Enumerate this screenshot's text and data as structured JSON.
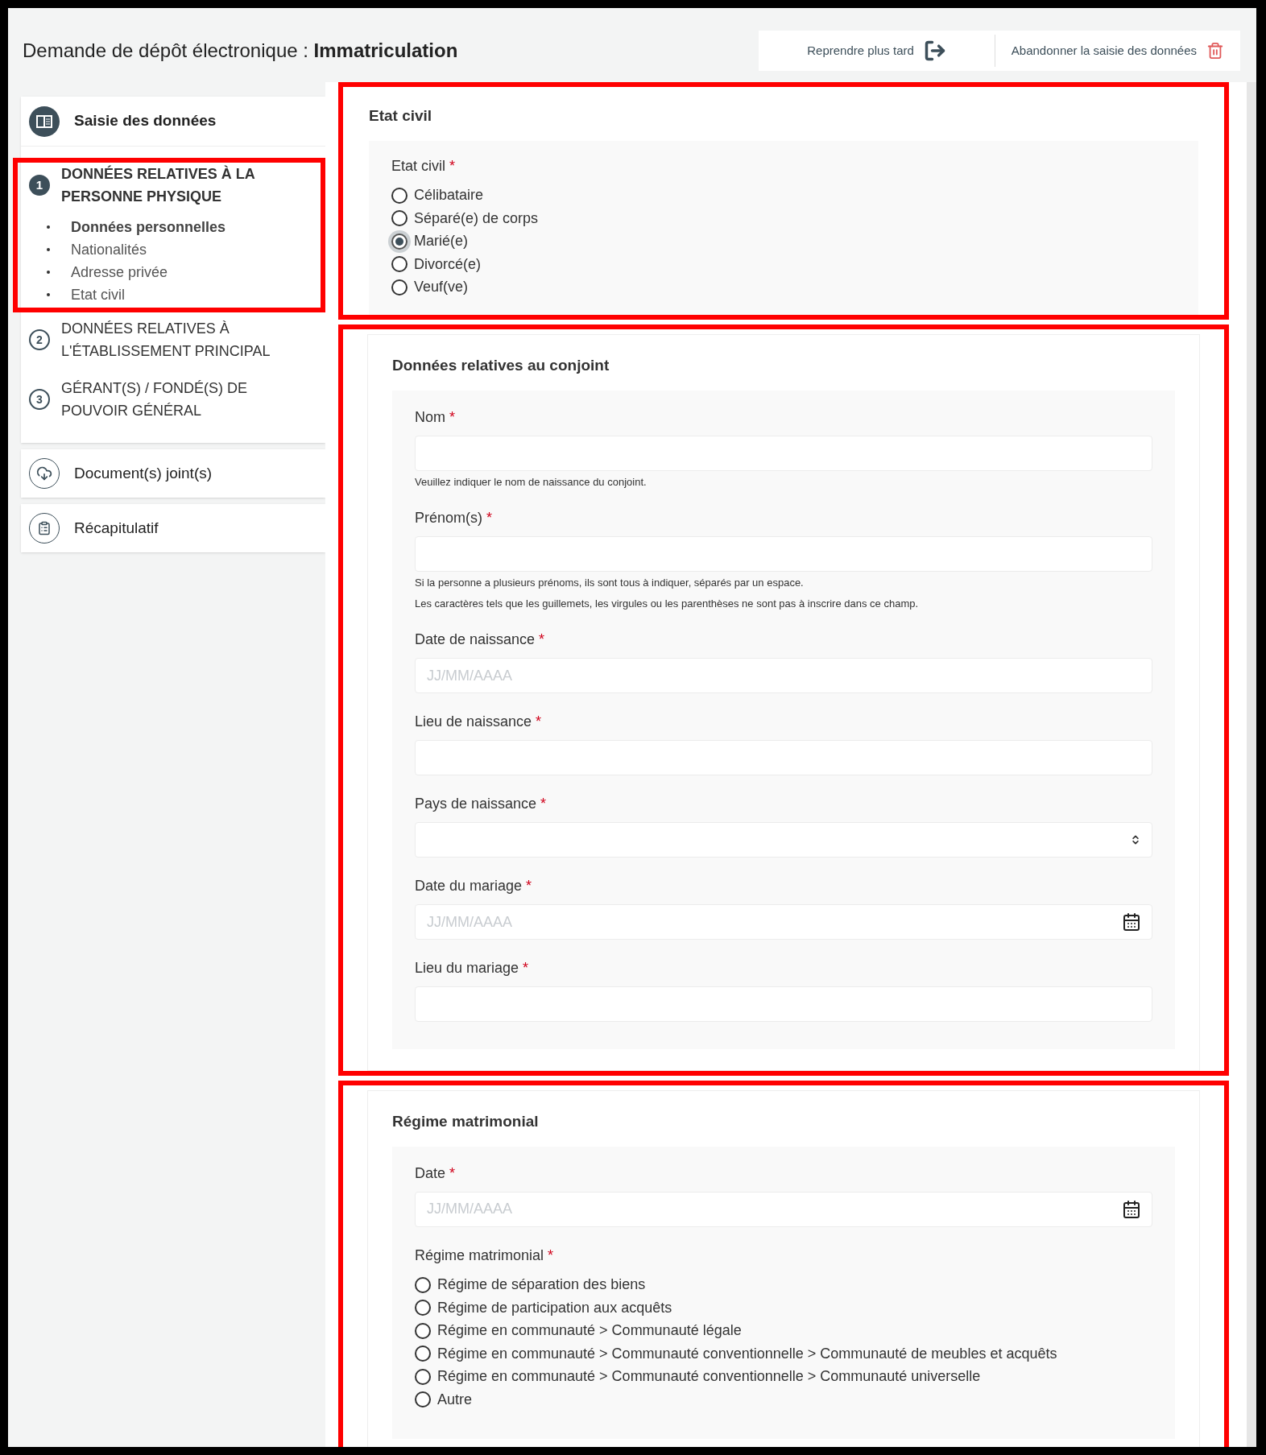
{
  "header": {
    "title_prefix": "Demande de dépôt électronique :",
    "title_bold": "Immatriculation",
    "actions": [
      {
        "kind": "resume",
        "label": "Reprendre plus tard"
      },
      {
        "kind": "abandon",
        "label": "Abandonner la saisie des données"
      }
    ]
  },
  "sidebar": {
    "title": "Saisie des données",
    "steps": [
      {
        "number": "1",
        "label_lines": [
          "DONNÉES RELATIVES À LA",
          "PERSONNE PHYSIQUE"
        ],
        "selected": true,
        "highlighted": true,
        "children": [
          {
            "label": "Données personnelles",
            "selected": true
          },
          {
            "label": "Nationalités",
            "selected": false
          },
          {
            "label": "Adresse privée",
            "selected": false
          },
          {
            "label": "Etat civil",
            "selected": false
          }
        ]
      },
      {
        "number": "2",
        "label_lines": [
          "DONNÉES RELATIVES À",
          "L'ÉTABLISSEMENT PRINCIPAL"
        ],
        "selected": false,
        "highlighted": false
      },
      {
        "number": "3",
        "label_lines": [
          "GÉRANT(S) / FONDÉ(S) DE",
          "POUVOIR GÉNÉRAL"
        ],
        "selected": false,
        "highlighted": false
      }
    ],
    "extra_items": [
      {
        "kind": "upload",
        "label": "Document(s) joint(s)"
      },
      {
        "kind": "summary",
        "label": "Récapitulatif"
      }
    ]
  },
  "sections": [
    {
      "title": "Etat civil",
      "highlighted": true,
      "fields": [
        {
          "kind": "radio",
          "label": "Etat civil",
          "required_mark": "*",
          "options": [
            {
              "label": "Célibataire",
              "selected": false
            },
            {
              "label": "Séparé(e) de corps",
              "selected": false
            },
            {
              "label": "Marié(e)",
              "selected": true
            },
            {
              "label": "Divorcé(e)",
              "selected": false
            },
            {
              "label": "Veuf(ve)",
              "selected": false
            }
          ]
        }
      ]
    },
    {
      "title": "Données relatives au conjoint",
      "highlighted": true,
      "fields": [
        {
          "kind": "text",
          "label": "Nom",
          "required_mark": "*",
          "hints": [
            "Veuillez indiquer le nom de naissance du conjoint."
          ]
        },
        {
          "kind": "text",
          "label": "Prénom(s)",
          "required_mark": "*",
          "hints": [
            "Si la personne a plusieurs prénoms, ils sont tous à indiquer, séparés par un espace.",
            "Les caractères tels que les guillemets, les virgules ou les parenthèses ne sont pas à inscrire dans ce champ."
          ]
        },
        {
          "kind": "text",
          "label": "Date de naissance",
          "required_mark": "*",
          "placeholder": "JJ/MM/AAAA"
        },
        {
          "kind": "text",
          "label": "Lieu de naissance",
          "required_mark": "*"
        },
        {
          "kind": "select",
          "label": "Pays de naissance",
          "required_mark": "*"
        },
        {
          "kind": "date",
          "label": "Date du mariage",
          "required_mark": "*",
          "placeholder": "JJ/MM/AAAA"
        },
        {
          "kind": "text",
          "label": "Lieu du mariage",
          "required_mark": "*"
        }
      ]
    },
    {
      "title": "Régime matrimonial",
      "highlighted": true,
      "fields": [
        {
          "kind": "date",
          "label": "Date",
          "required_mark": "*",
          "placeholder": "JJ/MM/AAAA"
        },
        {
          "kind": "radio",
          "label": "Régime matrimonial",
          "required_mark": "*",
          "options": [
            {
              "label": "Régime de séparation des biens",
              "selected": false
            },
            {
              "label": "Régime de participation aux acquêts",
              "selected": false
            },
            {
              "label": "Régime en communauté > Communauté légale",
              "selected": false
            },
            {
              "label": "Régime en communauté > Communauté conventionnelle > Communauté de meubles et acquêts",
              "selected": false
            },
            {
              "label": "Régime en communauté > Communauté conventionnelle > Communauté universelle",
              "selected": false
            },
            {
              "label": "Autre",
              "selected": false
            }
          ]
        }
      ]
    }
  ]
}
